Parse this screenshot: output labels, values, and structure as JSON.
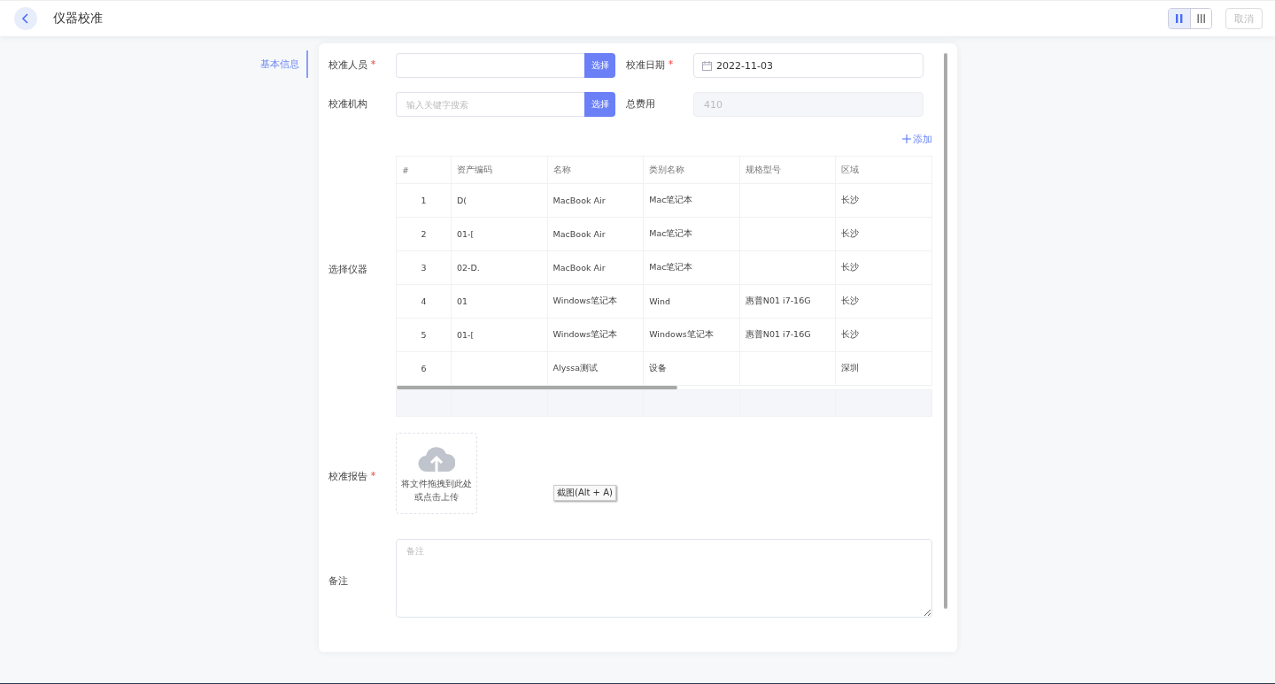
{
  "header": {
    "title": "仪器校准",
    "view_toggle": [
      {
        "kind": "two-column",
        "selected": true
      },
      {
        "kind": "three-column",
        "selected": false
      }
    ],
    "cancel": "取消"
  },
  "anchor_nav": [
    {
      "label": "基本信息",
      "selected": true
    }
  ],
  "form": {
    "fields": [
      {
        "kind": "picker",
        "label": "校准人员",
        "required": true,
        "button": "选择"
      },
      {
        "kind": "date",
        "label": "校准日期",
        "required": true,
        "value": "2022-11-03"
      },
      {
        "kind": "picker",
        "label": "校准机构",
        "required": false,
        "placeholder": "输入关键字搜索",
        "button": "选择"
      },
      {
        "kind": "readonly",
        "label": "总费用",
        "required": false,
        "value": "410"
      }
    ],
    "instruments": {
      "label": "选择仪器",
      "add": "添加",
      "columns": [
        "#",
        "资产编码",
        "名称",
        "类别名称",
        "规格型号",
        "区域"
      ],
      "rows": [
        [
          "1",
          "D(",
          "MacBook Air",
          "Mac笔记本",
          "",
          "长沙"
        ],
        [
          "2",
          "01-[",
          "MacBook Air",
          "Mac笔记本",
          "",
          "长沙"
        ],
        [
          "3",
          "02-D.",
          "MacBook Air",
          "Mac笔记本",
          "",
          "长沙"
        ],
        [
          "4",
          "01",
          "Windows笔记本",
          "Wind",
          "惠普N01 i7-16G",
          "长沙"
        ],
        [
          "5",
          "01-[",
          "Windows笔记本",
          "Windows笔记本",
          "惠普N01 i7-16G",
          "长沙"
        ],
        [
          "6",
          "",
          "Alyssa测试",
          "设备",
          "",
          "深圳"
        ]
      ]
    },
    "report": {
      "label": "校准报告",
      "required": true,
      "upload_text": [
        "将文件拖拽到此处",
        "或点击上传"
      ],
      "tooltip": "截图(Alt + A)"
    },
    "remarks": {
      "label": "备注",
      "placeholder": "备注"
    }
  }
}
